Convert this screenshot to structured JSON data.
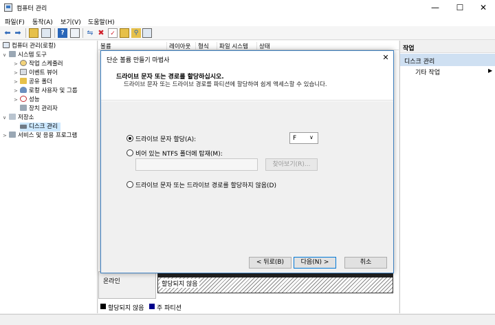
{
  "window": {
    "title": "컴퓨터 관리",
    "minimize": "—",
    "maximize": "☐",
    "close": "✕"
  },
  "menubar": {
    "items": [
      "파일(F)",
      "동작(A)",
      "보기(V)",
      "도움말(H)"
    ]
  },
  "toolbar": {
    "icons": [
      "back-arrow-icon",
      "forward-arrow-icon",
      "up-folder-icon",
      "console-tree-icon",
      "help-icon",
      "properties-icon",
      "connect-icon",
      "delete-icon",
      "check-icon",
      "export-icon",
      "search-icon",
      "view-icon"
    ]
  },
  "tree": {
    "root": "컴퓨터 관리(로컬)",
    "system_tools": "시스템 도구",
    "task_scheduler": "작업 스케줄러",
    "event_viewer": "이벤트 뷰어",
    "shared_folders": "공유 폴더",
    "local_users": "로컬 사용자 및 그룹",
    "performance": "성능",
    "device_manager": "장치 관리자",
    "storage": "저장소",
    "disk_management": "디스크 관리",
    "services": "서비스 및 응용 프로그램"
  },
  "columns": [
    "볼륨",
    "레이아웃",
    "형식",
    "파일 시스템",
    "상태"
  ],
  "disk": {
    "status": "온라인",
    "unallocated": "할당되지 않음"
  },
  "legend": {
    "unallocated": "할당되지 않음",
    "primary": "주 파티션",
    "unallocated_color": "#000000",
    "primary_color": "#00008b"
  },
  "actions": {
    "title": "작업",
    "section": "디스크 관리",
    "more": "기타 작업"
  },
  "dialog": {
    "title": "단순 볼륨 만들기 마법사",
    "close": "✕",
    "heading": "드라이브 문자 또는 경로를 할당하십시오.",
    "description": "드라이브 문자 또는 드라이브 경로를 파티션에 할당하여 쉽게 액세스할 수 있습니다.",
    "options": {
      "assign_letter": "드라이브 문자 할당(A):",
      "mount_ntfs": "비어 있는 NTFS 폴더에 탑재(M):",
      "no_assign": "드라이브 문자 또는 드라이브 경로를 할당하지 않음(D)"
    },
    "selected_option": "assign_letter",
    "drive_letter": "F",
    "ntfs_path": "",
    "browse": "찾아보기(R)...",
    "back": "< 뒤로(B)",
    "next": "다음(N) >",
    "cancel": "취소"
  },
  "colors": {
    "accent": "#3c7fc0",
    "selection": "#cce8ff",
    "actions_section": "#cfe0f2"
  }
}
